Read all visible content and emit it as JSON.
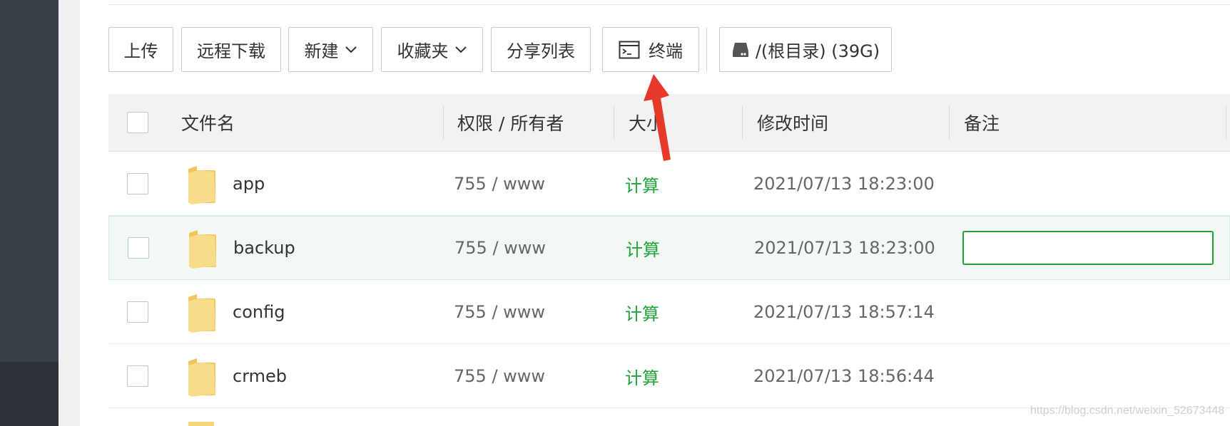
{
  "toolbar": {
    "upload": "上传",
    "remote_download": "远程下载",
    "new": "新建",
    "favorites": "收藏夹",
    "share_list": "分享列表",
    "terminal": "终端",
    "path": "/(根目录) (39G)"
  },
  "table": {
    "headers": {
      "name": "文件名",
      "permission": "权限 / 所有者",
      "size": "大小",
      "modified": "修改时间",
      "note": "备注"
    },
    "rows": [
      {
        "name": "app",
        "permission": "755 / www",
        "size": "计算",
        "modified": "2021/07/13 18:23:00",
        "note": ""
      },
      {
        "name": "backup",
        "permission": "755 / www",
        "size": "计算",
        "modified": "2021/07/13 18:23:00",
        "note": ""
      },
      {
        "name": "config",
        "permission": "755 / www",
        "size": "计算",
        "modified": "2021/07/13 18:57:14",
        "note": ""
      },
      {
        "name": "crmeb",
        "permission": "755 / www",
        "size": "计算",
        "modified": "2021/07/13 18:56:44",
        "note": ""
      }
    ]
  },
  "watermark": "https://blog.csdn.net/weixin_52673448",
  "colors": {
    "accent": "#20a53a",
    "arrow": "#e53a2a",
    "folder": "#f5d67a"
  }
}
